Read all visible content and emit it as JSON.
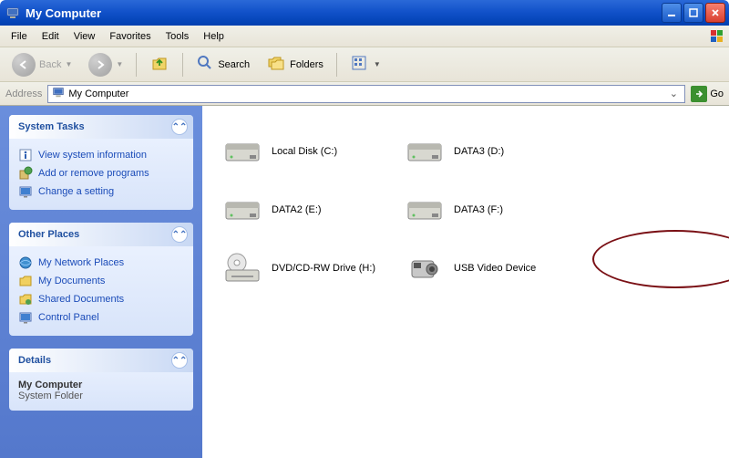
{
  "titlebar": {
    "title": "My Computer"
  },
  "menubar": {
    "items": [
      "File",
      "Edit",
      "View",
      "Favorites",
      "Tools",
      "Help"
    ]
  },
  "toolbar": {
    "back": "Back",
    "search": "Search",
    "folders": "Folders"
  },
  "addressbar": {
    "label": "Address",
    "value": "My Computer",
    "go": "Go"
  },
  "sidebar": {
    "systemTasks": {
      "title": "System Tasks",
      "links": [
        {
          "label": "View system information",
          "icon": "info"
        },
        {
          "label": "Add or remove programs",
          "icon": "programs"
        },
        {
          "label": "Change a setting",
          "icon": "setting"
        }
      ]
    },
    "otherPlaces": {
      "title": "Other Places",
      "links": [
        {
          "label": "My Network Places",
          "icon": "network"
        },
        {
          "label": "My Documents",
          "icon": "documents"
        },
        {
          "label": "Shared Documents",
          "icon": "shared"
        },
        {
          "label": "Control Panel",
          "icon": "control"
        }
      ]
    },
    "details": {
      "title": "Details",
      "name": "My Computer",
      "type": "System Folder"
    }
  },
  "content": {
    "items": [
      {
        "label": "Local Disk (C:)",
        "icon": "hdd"
      },
      {
        "label": "DATA3 (D:)",
        "icon": "hdd"
      },
      {
        "label": "DATA2 (E:)",
        "icon": "hdd"
      },
      {
        "label": "DATA3 (F:)",
        "icon": "hdd"
      },
      {
        "label": "DVD/CD-RW Drive (H:)",
        "icon": "optical"
      },
      {
        "label": "USB Video Device",
        "icon": "camera"
      }
    ]
  }
}
